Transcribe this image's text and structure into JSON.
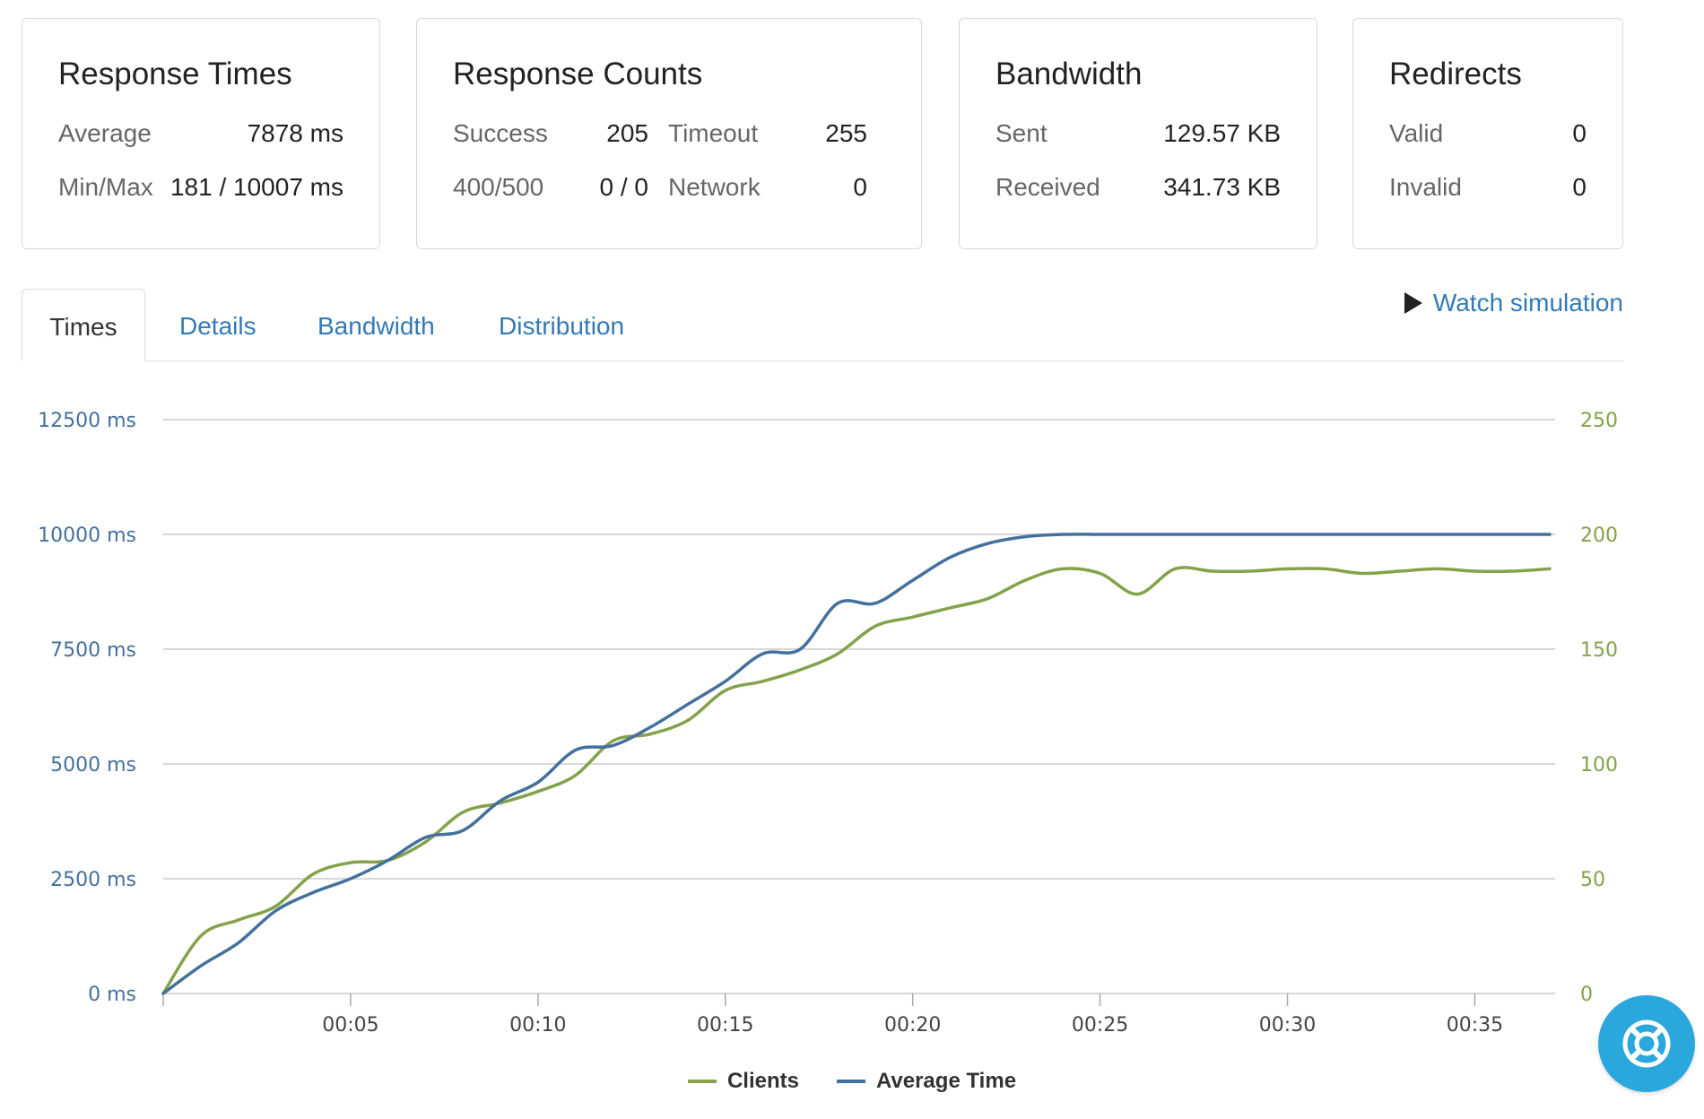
{
  "cards": {
    "response_times": {
      "title": "Response Times",
      "average_label": "Average",
      "average_value": "7878 ms",
      "minmax_label": "Min/Max",
      "minmax_value": "181 / 10007 ms"
    },
    "response_counts": {
      "title": "Response Counts",
      "success_label": "Success",
      "success_value": "205",
      "timeout_label": "Timeout",
      "timeout_value": "255",
      "errors_label": "400/500",
      "errors_value": "0 / 0",
      "network_label": "Network",
      "network_value": "0"
    },
    "bandwidth": {
      "title": "Bandwidth",
      "sent_label": "Sent",
      "sent_value": "129.57 KB",
      "received_label": "Received",
      "received_value": "341.73 KB"
    },
    "redirects": {
      "title": "Redirects",
      "valid_label": "Valid",
      "valid_value": "0",
      "invalid_label": "Invalid",
      "invalid_value": "0"
    }
  },
  "tabs": [
    {
      "label": "Times",
      "active": true
    },
    {
      "label": "Details",
      "active": false
    },
    {
      "label": "Bandwidth",
      "active": false
    },
    {
      "label": "Distribution",
      "active": false
    }
  ],
  "watch_simulation_label": "Watch simulation",
  "colors": {
    "clients": "#84a24a",
    "average_time": "#44709d",
    "link": "#337ab7",
    "help_button": "#2aa8dd"
  },
  "icons": {
    "play": "play-icon",
    "help": "lifebuoy-icon"
  },
  "chart_data": {
    "type": "line",
    "x_ticks": [
      "00:05",
      "00:10",
      "00:15",
      "00:20",
      "00:25",
      "00:30",
      "00:35"
    ],
    "xlim_seconds": [
      0,
      37
    ],
    "y_left": {
      "ticks": [
        "12500 ms",
        "10000 ms",
        "7500 ms",
        "5000 ms",
        "2500 ms",
        "0 ms"
      ],
      "lim": [
        0,
        12500
      ]
    },
    "y_right": {
      "ticks": [
        "250",
        "200",
        "150",
        "100",
        "50",
        "0"
      ],
      "lim": [
        0,
        250
      ]
    },
    "grid": true,
    "legend_position": "bottom-center",
    "series": [
      {
        "name": "Clients",
        "axis": "right",
        "points": [
          [
            0,
            0
          ],
          [
            1,
            25
          ],
          [
            2,
            32
          ],
          [
            3,
            38
          ],
          [
            4,
            52
          ],
          [
            5,
            57
          ],
          [
            6,
            58
          ],
          [
            7,
            66
          ],
          [
            8,
            79
          ],
          [
            9,
            83
          ],
          [
            10,
            88
          ],
          [
            11,
            95
          ],
          [
            12,
            110
          ],
          [
            13,
            113
          ],
          [
            14,
            119
          ],
          [
            15,
            132
          ],
          [
            16,
            136
          ],
          [
            17,
            141
          ],
          [
            18,
            148
          ],
          [
            19,
            160
          ],
          [
            20,
            164
          ],
          [
            21,
            168
          ],
          [
            22,
            172
          ],
          [
            23,
            180
          ],
          [
            24,
            185
          ],
          [
            25,
            183
          ],
          [
            26,
            174
          ],
          [
            27,
            185
          ],
          [
            28,
            184
          ],
          [
            29,
            184
          ],
          [
            30,
            185
          ],
          [
            31,
            185
          ],
          [
            32,
            183
          ],
          [
            33,
            184
          ],
          [
            34,
            185
          ],
          [
            35,
            184
          ],
          [
            36,
            184
          ],
          [
            37,
            185
          ]
        ]
      },
      {
        "name": "Average Time",
        "axis": "left",
        "points": [
          [
            0,
            0
          ],
          [
            1,
            600
          ],
          [
            2,
            1100
          ],
          [
            3,
            1800
          ],
          [
            4,
            2200
          ],
          [
            5,
            2500
          ],
          [
            6,
            2900
          ],
          [
            7,
            3400
          ],
          [
            8,
            3550
          ],
          [
            9,
            4200
          ],
          [
            10,
            4600
          ],
          [
            11,
            5300
          ],
          [
            12,
            5400
          ],
          [
            13,
            5800
          ],
          [
            14,
            6300
          ],
          [
            15,
            6800
          ],
          [
            16,
            7400
          ],
          [
            17,
            7500
          ],
          [
            18,
            8500
          ],
          [
            19,
            8500
          ],
          [
            20,
            9000
          ],
          [
            21,
            9500
          ],
          [
            22,
            9800
          ],
          [
            23,
            9950
          ],
          [
            24,
            10000
          ],
          [
            25,
            10000
          ],
          [
            26,
            10000
          ],
          [
            27,
            10000
          ],
          [
            28,
            10000
          ],
          [
            29,
            10000
          ],
          [
            30,
            10000
          ],
          [
            31,
            10000
          ],
          [
            32,
            10000
          ],
          [
            33,
            10000
          ],
          [
            34,
            10000
          ],
          [
            35,
            10000
          ],
          [
            36,
            10000
          ],
          [
            37,
            10000
          ]
        ]
      }
    ]
  }
}
